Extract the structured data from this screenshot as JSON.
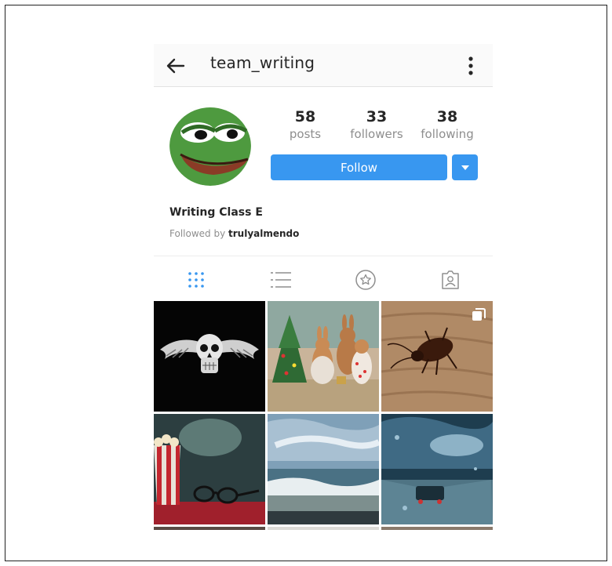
{
  "header": {
    "username": "team_writing"
  },
  "profile": {
    "stats": [
      {
        "value": "58",
        "label": "posts"
      },
      {
        "value": "33",
        "label": "followers"
      },
      {
        "value": "38",
        "label": "following"
      }
    ],
    "follow_label": "Follow",
    "display_name": "Writing Class E",
    "followed_by_prefix": "Followed by",
    "followed_by_user": "trulyalmendo"
  },
  "tabs": [
    {
      "name": "grid",
      "icon": "grid-icon",
      "active": true
    },
    {
      "name": "list",
      "icon": "list-icon",
      "active": false
    },
    {
      "name": "saved",
      "icon": "star-icon",
      "active": false
    },
    {
      "name": "tagged",
      "icon": "tagged-person-icon",
      "active": false
    }
  ],
  "grid": {
    "posts": [
      {
        "subject": "winged skull logo"
      },
      {
        "subject": "rabbits christmas scene"
      },
      {
        "subject": "cockroach on wood",
        "multiple": true
      },
      {
        "subject": "popcorn and glasses"
      },
      {
        "subject": "ocean waves"
      },
      {
        "subject": "rainy road"
      }
    ]
  },
  "colors": {
    "accent": "#3897f0",
    "text": "#262626",
    "muted": "#8e8e8e"
  }
}
